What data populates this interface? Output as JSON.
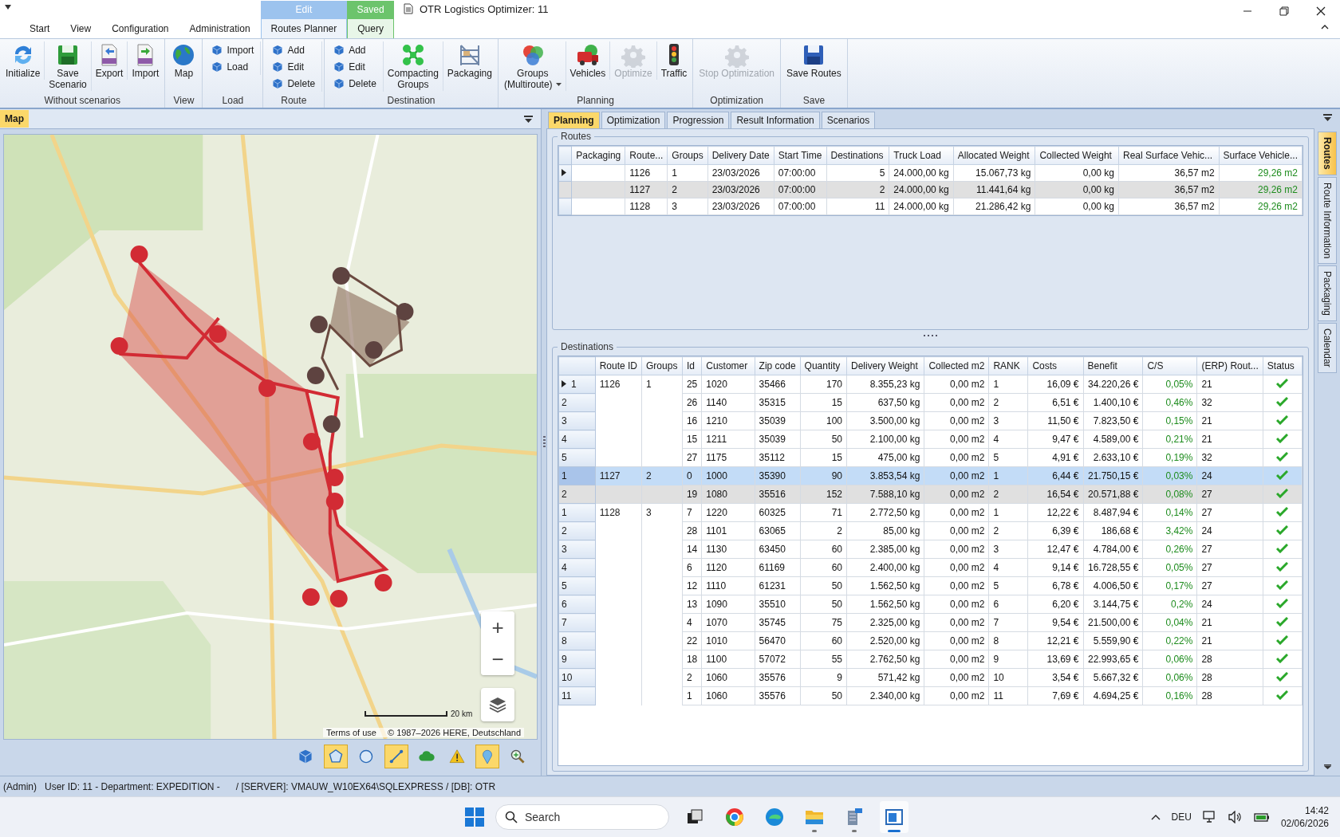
{
  "window": {
    "title": "OTR Logistics Optimizer: 11"
  },
  "ribbon_tabs": [
    {
      "label": "Start",
      "selected": false
    },
    {
      "label": "View",
      "selected": false
    },
    {
      "label": "Configuration",
      "selected": false
    },
    {
      "label": "Administration",
      "selected": false
    },
    {
      "label": "Routes Planner",
      "selected": true,
      "context": "Edit",
      "color": "#9cc3ee"
    },
    {
      "label": "Query",
      "selected": false,
      "context": "Saved",
      "color": "#6cc46c"
    }
  ],
  "ribbon": {
    "groups": [
      {
        "label": "Without scenarios",
        "items": [
          {
            "kind": "large",
            "lines": [
              "Initialize"
            ],
            "disabled": false
          },
          {
            "kind": "large",
            "lines": [
              "Save",
              "Scenario"
            ],
            "disabled": false
          },
          {
            "kind": "large",
            "lines": [
              "Export"
            ],
            "disabled": false
          },
          {
            "kind": "large",
            "lines": [
              "Import"
            ],
            "disabled": false
          }
        ]
      },
      {
        "label": "View",
        "items": [
          {
            "kind": "large",
            "lines": [
              "Map"
            ],
            "disabled": false
          }
        ]
      },
      {
        "label": "Load",
        "items": [
          {
            "kind": "stack",
            "buttons": [
              {
                "label": "Import"
              },
              {
                "label": "Load"
              }
            ]
          }
        ]
      },
      {
        "label": "Route",
        "items": [
          {
            "kind": "stack",
            "buttons": [
              {
                "label": "Add"
              },
              {
                "label": "Edit"
              },
              {
                "label": "Delete"
              }
            ]
          }
        ]
      },
      {
        "label": "Destination",
        "items": [
          {
            "kind": "stack",
            "buttons": [
              {
                "label": "Add"
              },
              {
                "label": "Edit"
              },
              {
                "label": "Delete"
              }
            ]
          },
          {
            "kind": "large",
            "lines": [
              "Compacting",
              "Groups"
            ],
            "disabled": false
          },
          {
            "kind": "large",
            "lines": [
              "Packaging"
            ],
            "disabled": false
          }
        ]
      },
      {
        "label": "Planning",
        "items": [
          {
            "kind": "dropdown",
            "lines": [
              "Groups",
              "(Multiroute)"
            ],
            "disabled": false
          },
          {
            "kind": "large",
            "lines": [
              "Vehicles"
            ],
            "disabled": false
          },
          {
            "kind": "large",
            "lines": [
              "Optimize"
            ],
            "disabled": true
          },
          {
            "kind": "large",
            "lines": [
              "Traffic"
            ],
            "disabled": false
          }
        ]
      },
      {
        "label": "Optimization",
        "items": [
          {
            "kind": "large",
            "lines": [
              "Stop Optimization"
            ],
            "disabled": true
          }
        ]
      },
      {
        "label": "Save",
        "items": [
          {
            "kind": "large",
            "lines": [
              "Save Routes"
            ],
            "disabled": false
          }
        ]
      }
    ]
  },
  "map_panel": {
    "title": "Map",
    "zoom_in": "+",
    "zoom_out": "−",
    "scale": "20 km",
    "terms": "Terms of use",
    "copyright": "© 1987–2026 HERE, Deutschland",
    "tools": [
      {
        "selected": false
      },
      {
        "selected": true
      },
      {
        "selected": false
      },
      {
        "selected": true
      },
      {
        "selected": false
      },
      {
        "selected": false
      },
      {
        "selected": true
      },
      {
        "selected": false
      }
    ]
  },
  "tabs": [
    {
      "label": "Planning",
      "selected": true
    },
    {
      "label": "Optimization",
      "selected": false
    },
    {
      "label": "Progression",
      "selected": false
    },
    {
      "label": "Result Information",
      "selected": false
    },
    {
      "label": "Scenarios",
      "selected": false
    }
  ],
  "side_tabs": [
    {
      "label": "Routes",
      "selected": true
    },
    {
      "label": "Route Information",
      "selected": false
    },
    {
      "label": "Packaging",
      "selected": false
    },
    {
      "label": "Calendar",
      "selected": false
    }
  ],
  "routes": {
    "title": "Routes",
    "columns": [
      {
        "label": "Packaging"
      },
      {
        "label": "Route..."
      },
      {
        "label": "Groups"
      },
      {
        "label": "Delivery Date"
      },
      {
        "label": "Start Time"
      },
      {
        "label": "Destinations"
      },
      {
        "label": "Truck Load"
      },
      {
        "label": "Allocated Weight"
      },
      {
        "label": "Collected Weight"
      },
      {
        "label": "Real  Surface Vehic..."
      },
      {
        "label": "Surface  Vehicle...",
        "color": "#1e8c1e"
      }
    ],
    "rows": [
      {
        "current": true,
        "highlighted": false,
        "cells": [
          null,
          "1126",
          "1",
          "23/03/2026",
          "07:00:00",
          "5",
          "24.000,00 kg",
          "15.067,73 kg",
          "0,00 kg",
          "36,57 m2",
          "29,26 m2"
        ]
      },
      {
        "current": false,
        "highlighted": true,
        "cells": [
          null,
          "1127",
          "2",
          "23/03/2026",
          "07:00:00",
          "2",
          "24.000,00 kg",
          "11.441,64 kg",
          "0,00 kg",
          "36,57 m2",
          "29,26 m2"
        ]
      },
      {
        "current": false,
        "highlighted": false,
        "cells": [
          null,
          "1128",
          "3",
          "23/03/2026",
          "07:00:00",
          "11",
          "24.000,00 kg",
          "21.286,42 kg",
          "0,00 kg",
          "36,57 m2",
          "29,26 m2"
        ]
      }
    ]
  },
  "destinations": {
    "title": "Destinations",
    "columns": [
      {
        "label": "Route ID"
      },
      {
        "label": "Groups"
      },
      {
        "label": "Id"
      },
      {
        "label": "Customer"
      },
      {
        "label": "Zip code"
      },
      {
        "label": "Quantity"
      },
      {
        "label": "Delivery Weight"
      },
      {
        "label": "Collected m2"
      },
      {
        "label": "RANK"
      },
      {
        "label": "Costs"
      },
      {
        "label": "Benefit"
      },
      {
        "label": "C/S",
        "color": "#1e8c1e"
      },
      {
        "label": "(ERP) Rout..."
      },
      {
        "label": "Status"
      }
    ],
    "groups": [
      {
        "route_id": "1126",
        "groups": "1",
        "rows": [
          {
            "num": "1",
            "current": true,
            "selected": false,
            "highlighted": false,
            "ok": true,
            "cells": [
              "25",
              "1020",
              "35466",
              "170",
              "8.355,23 kg",
              "0,00 m2",
              "1",
              "16,09 €",
              "34.220,26 €",
              "0,05%",
              "21"
            ]
          },
          {
            "num": "2",
            "current": false,
            "selected": false,
            "highlighted": false,
            "ok": true,
            "cells": [
              "26",
              "1140",
              "35315",
              "15",
              "637,50 kg",
              "0,00 m2",
              "2",
              "6,51 €",
              "1.400,10 €",
              "0,46%",
              "32"
            ]
          },
          {
            "num": "3",
            "current": false,
            "selected": false,
            "highlighted": false,
            "ok": true,
            "cells": [
              "16",
              "1210",
              "35039",
              "100",
              "3.500,00 kg",
              "0,00 m2",
              "3",
              "11,50 €",
              "7.823,50 €",
              "0,15%",
              "21"
            ]
          },
          {
            "num": "4",
            "current": false,
            "selected": false,
            "highlighted": false,
            "ok": true,
            "cells": [
              "15",
              "1211",
              "35039",
              "50",
              "2.100,00 kg",
              "0,00 m2",
              "4",
              "9,47 €",
              "4.589,00 €",
              "0,21%",
              "21"
            ]
          },
          {
            "num": "5",
            "current": false,
            "selected": false,
            "highlighted": false,
            "ok": true,
            "cells": [
              "27",
              "1175",
              "35112",
              "15",
              "475,00 kg",
              "0,00 m2",
              "5",
              "4,91 €",
              "2.633,10 €",
              "0,19%",
              "32"
            ]
          }
        ]
      },
      {
        "route_id": "1127",
        "groups": "2",
        "rows": [
          {
            "num": "1",
            "current": false,
            "selected": true,
            "highlighted": false,
            "ok": true,
            "cells": [
              "0",
              "1000",
              "35390",
              "90",
              "3.853,54 kg",
              "0,00 m2",
              "1",
              "6,44 €",
              "21.750,15 €",
              "0,03%",
              "24"
            ]
          },
          {
            "num": "2",
            "current": false,
            "selected": false,
            "highlighted": true,
            "ok": true,
            "cells": [
              "19",
              "1080",
              "35516",
              "152",
              "7.588,10 kg",
              "0,00 m2",
              "2",
              "16,54 €",
              "20.571,88 €",
              "0,08%",
              "27"
            ]
          }
        ]
      },
      {
        "route_id": "1128",
        "groups": "3",
        "rows": [
          {
            "num": "1",
            "current": false,
            "selected": false,
            "highlighted": false,
            "ok": true,
            "cells": [
              "7",
              "1220",
              "60325",
              "71",
              "2.772,50 kg",
              "0,00 m2",
              "1",
              "12,22 €",
              "8.487,94 €",
              "0,14%",
              "27"
            ]
          },
          {
            "num": "2",
            "current": false,
            "selected": false,
            "highlighted": false,
            "ok": true,
            "cells": [
              "28",
              "1101",
              "63065",
              "2",
              "85,00 kg",
              "0,00 m2",
              "2",
              "6,39 €",
              "186,68 €",
              "3,42%",
              "24"
            ]
          },
          {
            "num": "3",
            "current": false,
            "selected": false,
            "highlighted": false,
            "ok": true,
            "cells": [
              "14",
              "1130",
              "63450",
              "60",
              "2.385,00 kg",
              "0,00 m2",
              "3",
              "12,47 €",
              "4.784,00 €",
              "0,26%",
              "27"
            ]
          },
          {
            "num": "4",
            "current": false,
            "selected": false,
            "highlighted": false,
            "ok": true,
            "cells": [
              "6",
              "1120",
              "61169",
              "60",
              "2.400,00 kg",
              "0,00 m2",
              "4",
              "9,14 €",
              "16.728,55 €",
              "0,05%",
              "27"
            ]
          },
          {
            "num": "5",
            "current": false,
            "selected": false,
            "highlighted": false,
            "ok": true,
            "cells": [
              "12",
              "1110",
              "61231",
              "50",
              "1.562,50 kg",
              "0,00 m2",
              "5",
              "6,78 €",
              "4.006,50 €",
              "0,17%",
              "27"
            ]
          },
          {
            "num": "6",
            "current": false,
            "selected": false,
            "highlighted": false,
            "ok": true,
            "cells": [
              "13",
              "1090",
              "35510",
              "50",
              "1.562,50 kg",
              "0,00 m2",
              "6",
              "6,20 €",
              "3.144,75 €",
              "0,2%",
              "24"
            ]
          },
          {
            "num": "7",
            "current": false,
            "selected": false,
            "highlighted": false,
            "ok": true,
            "cells": [
              "4",
              "1070",
              "35745",
              "75",
              "2.325,00 kg",
              "0,00 m2",
              "7",
              "9,54 €",
              "21.500,00 €",
              "0,04%",
              "21"
            ]
          },
          {
            "num": "8",
            "current": false,
            "selected": false,
            "highlighted": false,
            "ok": true,
            "cells": [
              "22",
              "1010",
              "56470",
              "60",
              "2.520,00 kg",
              "0,00 m2",
              "8",
              "12,21 €",
              "5.559,90 €",
              "0,22%",
              "21"
            ]
          },
          {
            "num": "9",
            "current": false,
            "selected": false,
            "highlighted": false,
            "ok": true,
            "cells": [
              "18",
              "1100",
              "57072",
              "55",
              "2.762,50 kg",
              "0,00 m2",
              "9",
              "13,69 €",
              "22.993,65 €",
              "0,06%",
              "28"
            ]
          },
          {
            "num": "10",
            "current": false,
            "selected": false,
            "highlighted": false,
            "ok": true,
            "cells": [
              "2",
              "1060",
              "35576",
              "9",
              "571,42 kg",
              "0,00 m2",
              "10",
              "3,54 €",
              "5.667,32 €",
              "0,06%",
              "28"
            ]
          },
          {
            "num": "11",
            "current": false,
            "selected": false,
            "highlighted": false,
            "ok": true,
            "cells": [
              "1",
              "1060",
              "35576",
              "50",
              "2.340,00 kg",
              "0,00 m2",
              "11",
              "7,69 €",
              "4.694,25 €",
              "0,16%",
              "28"
            ]
          }
        ]
      }
    ]
  },
  "status_bar": {
    "texts": [
      "(Admin)",
      "User ID: 11 - Department: EXPEDITION -",
      "/ [SERVER]: VMAUW_W10EX64\\SQLEXPRESS / [DB]: OTR"
    ]
  },
  "taskbar": {
    "search": {
      "placeholder": "Search"
    },
    "apps": [
      {
        "active": false,
        "running": false
      },
      {
        "active": false,
        "running": false
      },
      {
        "active": false,
        "running": false
      },
      {
        "active": false,
        "running": true
      },
      {
        "active": false,
        "running": true
      },
      {
        "active": true,
        "running": true
      }
    ],
    "language": "DEU",
    "time": "14:42",
    "date": "02/06/2026"
  }
}
